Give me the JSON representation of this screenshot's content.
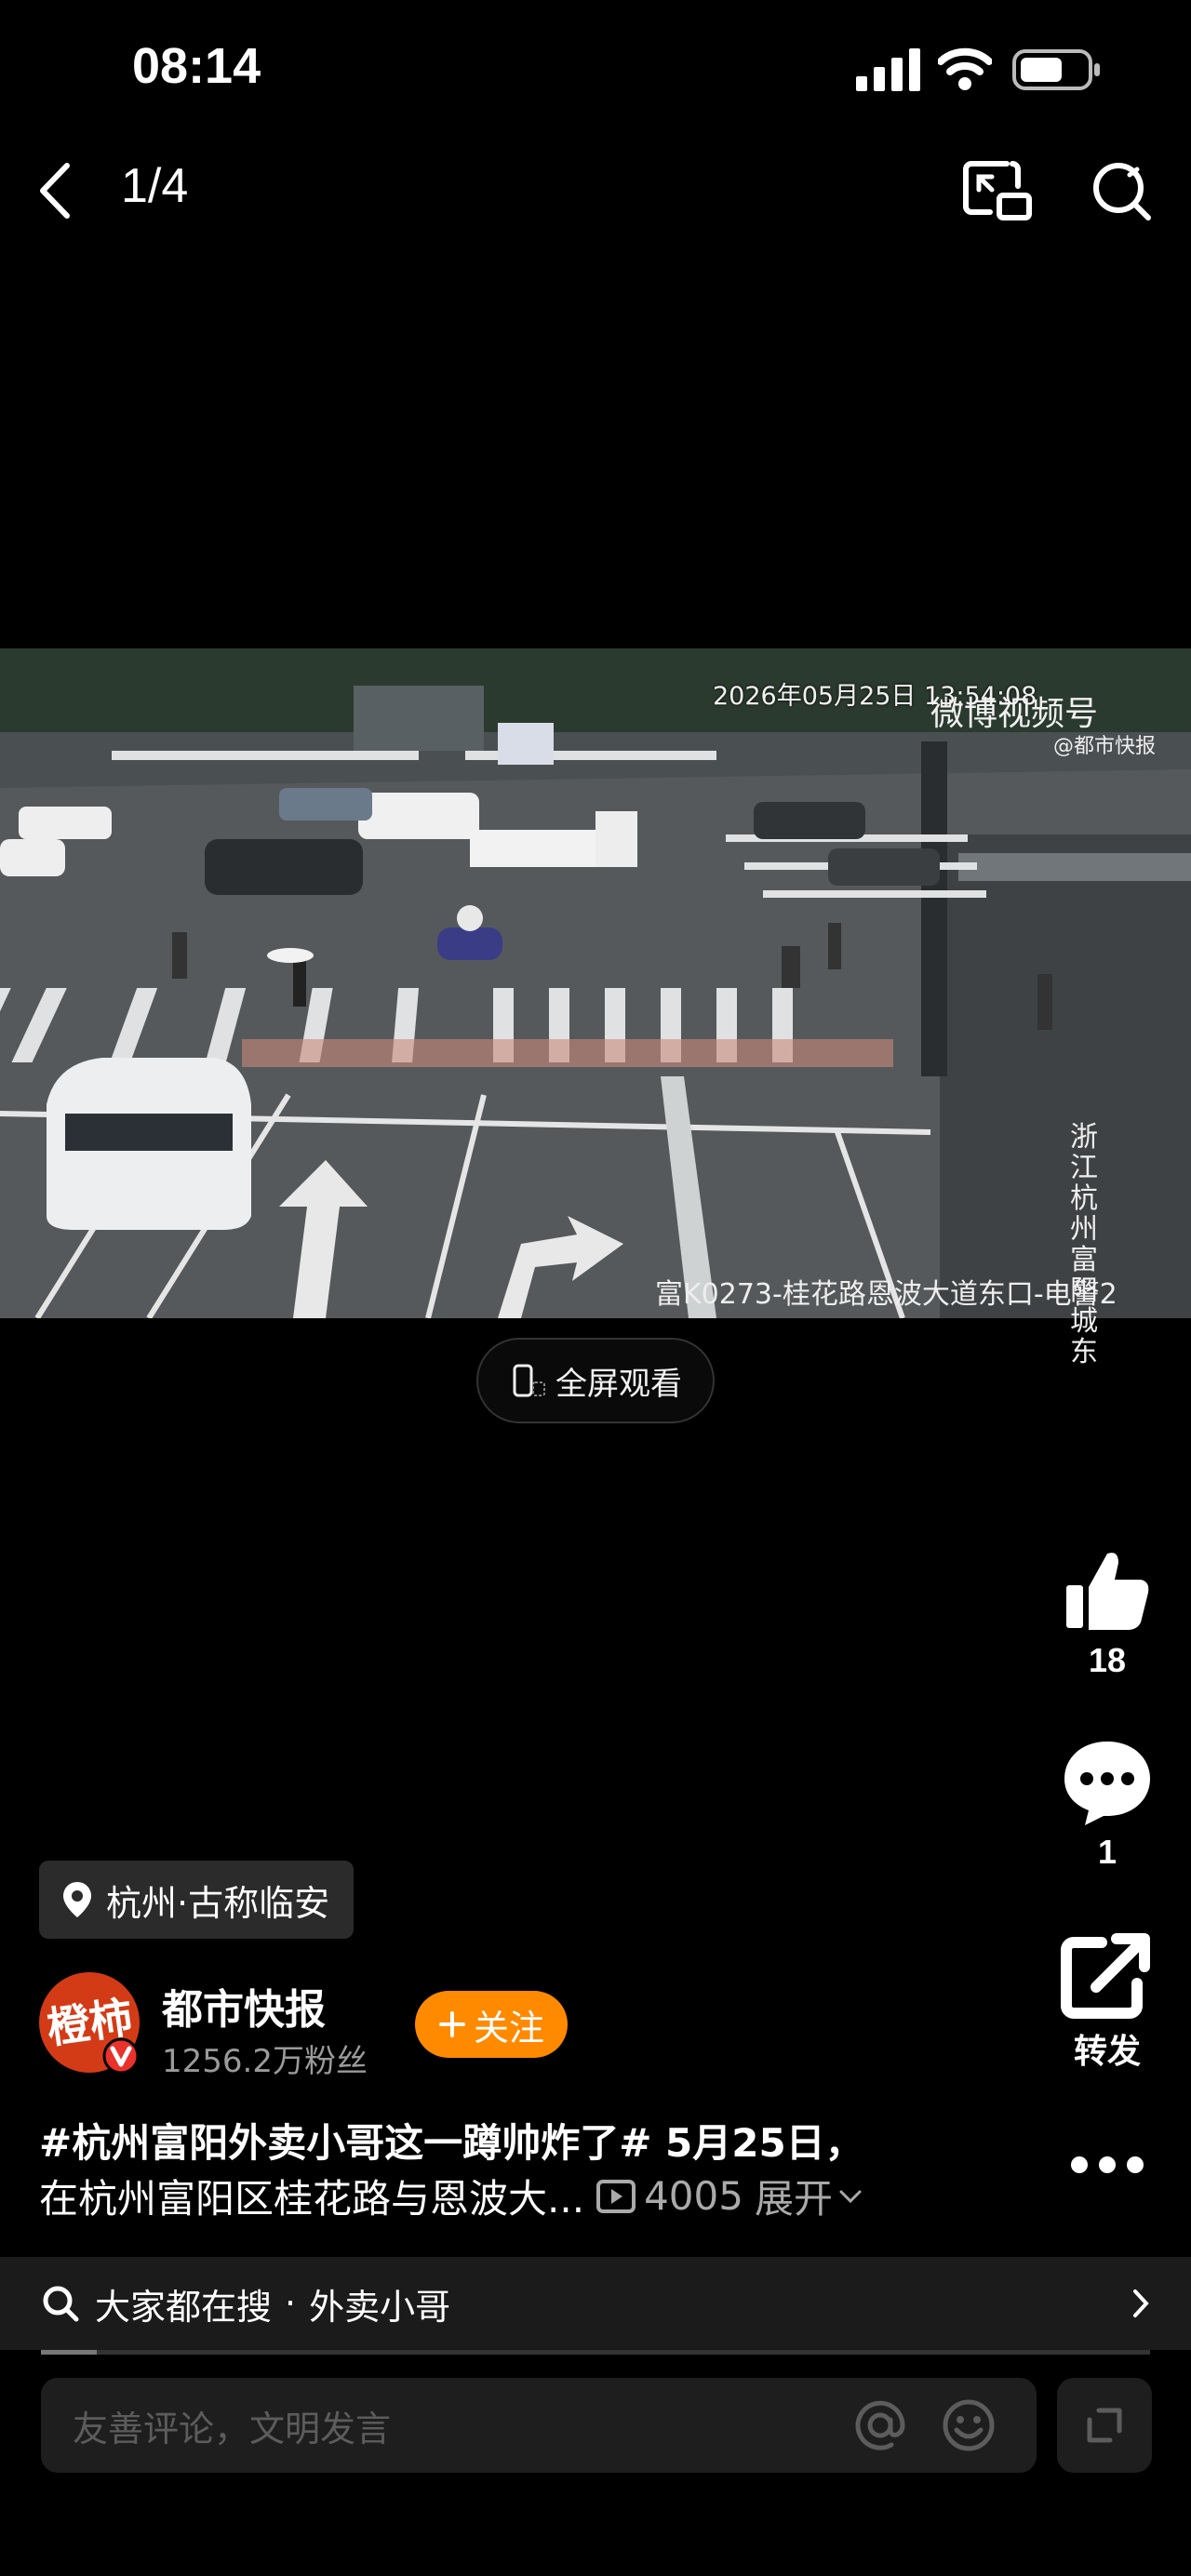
{
  "status_bar": {
    "time": "08:14"
  },
  "top_bar": {
    "counter": "1/4"
  },
  "video": {
    "timestamp": "2026年05月25日 13:54:08",
    "watermark": "微博视频号",
    "watermark_sub": "@都市快报",
    "location_overlay": "浙江杭州富阳城东",
    "camera_label": "富K0273-桂花路恩波大道东口-电警2"
  },
  "fullscreen_label": "全屏观看",
  "actions": {
    "like_count": "18",
    "comment_count": "1",
    "share_label": "转发"
  },
  "location_tag": "杭州·古称临安",
  "author": {
    "name": "都市快报",
    "fans": "1256.2万粉丝",
    "follow_label": "关注",
    "avatar_text": "橙柿"
  },
  "description": {
    "line1": "#杭州富阳外卖小哥这一蹲帅炸了# 5月25日，",
    "line2": "在杭州富阳区桂花路与恩波大...",
    "views": "4005",
    "expand": "展开"
  },
  "hot_search": {
    "prefix": "大家都在搜",
    "separator": "·",
    "term": "外卖小哥"
  },
  "progress": 0.05,
  "comment": {
    "placeholder": "友善评论，文明发言"
  },
  "colors": {
    "follow": "#ff8a00",
    "verified": "#e8322b",
    "background": "#000000"
  }
}
